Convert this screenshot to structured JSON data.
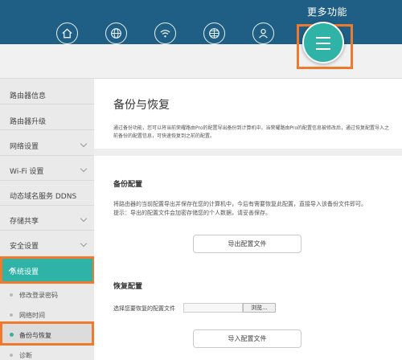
{
  "header": {
    "more_label": "更多功能",
    "icons": [
      "home-icon",
      "globe-icon",
      "wifi-icon",
      "network-globe-icon",
      "user-icon"
    ],
    "accent": "#1f5f85",
    "more_button_color": "#2fb3a6"
  },
  "sidebar": {
    "items": [
      {
        "label": "路由器信息"
      },
      {
        "label": "路由器升级"
      },
      {
        "label": "网络设置"
      },
      {
        "label": "Wi-Fi 设置"
      },
      {
        "label": "动态域名服务 DDNS"
      },
      {
        "label": "存储共享"
      },
      {
        "label": "安全设置"
      },
      {
        "label": "系统设置"
      }
    ],
    "sub_items": [
      {
        "label": "修改登录密码"
      },
      {
        "label": "网络时间"
      },
      {
        "label": "备份与恢复"
      },
      {
        "label": "诊断"
      }
    ],
    "active_color": "#2fb3a6",
    "highlight_color": "#ef7a2e"
  },
  "main": {
    "title": "备份与恢复",
    "description": "通过备份功能，您可以将当前荣耀路由Pro的配置导出备份到计算机中。当荣耀路由Pro的配置信息被修改后，通过恢复配置导入之前备份的配置信息，可快速恢复到之前的配置。",
    "backup": {
      "title": "备份配置",
      "text1": "将路由器的当前配置导出并保存在您的计算机中，今后有需要恢复此配置，直接导入该备份文件即可。",
      "text2": "提示：导出的配置文件会加密存储您的个人数据，请妥善保存。",
      "button": "导出配置文件"
    },
    "restore": {
      "title": "恢复配置",
      "file_label": "选择您要恢复的配置文件",
      "browse": "浏览...",
      "button": "导入配置文件"
    }
  }
}
